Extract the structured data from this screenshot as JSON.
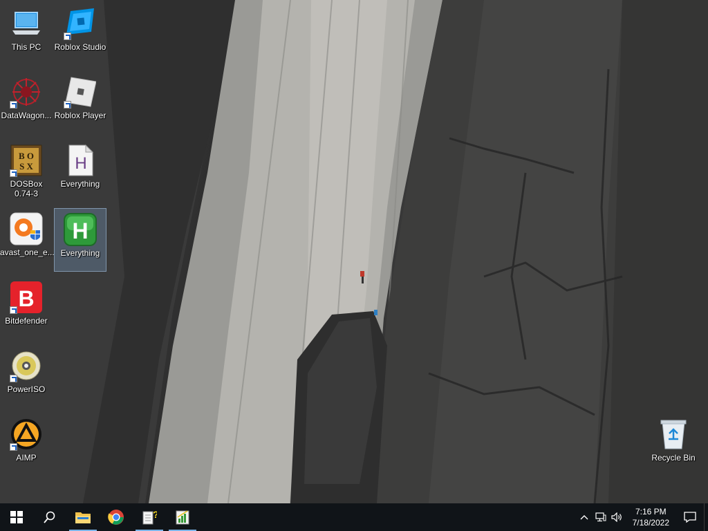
{
  "desktop": {
    "icons": [
      {
        "label": "This PC",
        "icon": "this-pc-icon",
        "shortcut": false
      },
      {
        "label": "Roblox Studio",
        "icon": "roblox-studio-icon",
        "shortcut": true
      },
      {
        "label": "DataWagon...",
        "icon": "datawagon-icon",
        "shortcut": true
      },
      {
        "label": "Roblox Player",
        "icon": "roblox-player-icon",
        "shortcut": true
      },
      {
        "label": "DOSBox\n0.74-3",
        "icon": "dosbox-icon",
        "shortcut": true
      },
      {
        "label": "Everything",
        "icon": "everything-document-icon",
        "shortcut": false
      },
      {
        "label": "avast_one_e...",
        "icon": "avast-icon",
        "shortcut": false
      },
      {
        "label": "Everything",
        "icon": "everything-app-icon",
        "shortcut": false,
        "selected": true
      },
      {
        "label": "Bitdefender",
        "icon": "bitdefender-icon",
        "shortcut": true
      },
      {
        "label": "PowerISO",
        "icon": "poweriso-icon",
        "shortcut": true
      },
      {
        "label": "AIMP",
        "icon": "aimp-icon",
        "shortcut": true
      },
      {
        "label": "Recycle Bin",
        "icon": "recycle-bin-icon",
        "shortcut": false
      }
    ]
  },
  "taskbar": {
    "buttons": [
      {
        "name": "start",
        "icon": "windows-logo-icon"
      },
      {
        "name": "search",
        "icon": "search-icon"
      },
      {
        "name": "file-explorer",
        "icon": "folder-icon",
        "active": true
      },
      {
        "name": "chrome",
        "icon": "chrome-icon"
      },
      {
        "name": "help-app",
        "icon": "help-document-icon",
        "active": true
      },
      {
        "name": "task-app",
        "icon": "chart-document-icon",
        "active": true
      }
    ],
    "tray": {
      "time": "7:16 PM",
      "date": "7/18/2022"
    },
    "colors": {
      "background": "#101418",
      "active_indicator": "#7ab4e8"
    }
  }
}
